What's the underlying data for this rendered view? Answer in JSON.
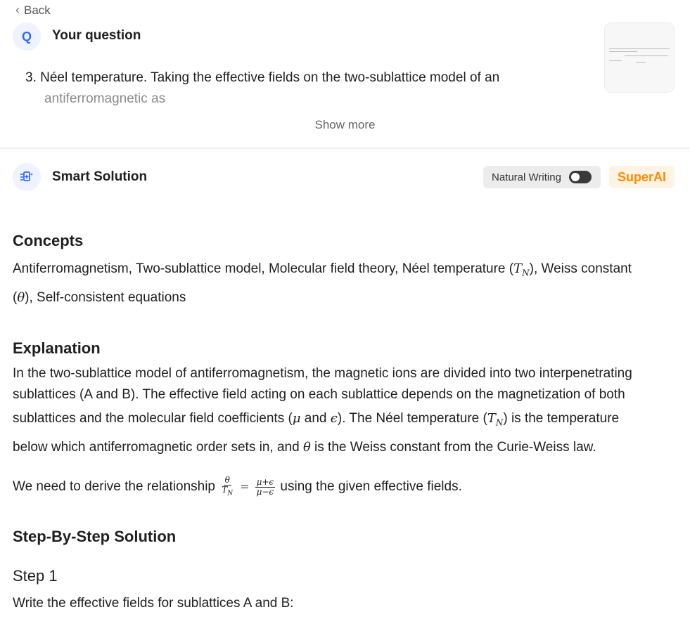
{
  "nav": {
    "back_label": "Back"
  },
  "question": {
    "badge": "Q",
    "title": "Your question",
    "number": "3.",
    "text_line1": "Néel temperature. Taking the effective fields on the two-sublattice model of an",
    "text_line2": "antiferromagnetic as",
    "show_more": "Show more"
  },
  "solution": {
    "title": "Smart Solution",
    "natural_writing_label": "Natural Writing",
    "natural_writing_on": false,
    "superai_label": "SuperAI"
  },
  "concepts": {
    "heading": "Concepts",
    "line1_a": "Antiferromagnetism, Two-sublattice model, Molecular field theory, Néel temperature (",
    "tn_T": "T",
    "tn_N": "N",
    "line1_b": "), Weiss constant",
    "line2_a": "(",
    "theta": "θ",
    "line2_b": "), Self-consistent equations"
  },
  "explanation": {
    "heading": "Explanation",
    "line1": "In the two-sublattice model of antiferromagnetism, the magnetic ions are divided into two interpenetrating",
    "line2": "sublattices (A and B). The effective field acting on each sublattice depends on the magnetization of both",
    "line3_a": "sublattices and the molecular field coefficients (",
    "mu": "μ",
    "and": " and ",
    "eps": "ϵ",
    "line3_b": "). The Néel temperature (",
    "tn_T": "T",
    "tn_N": "N",
    "line3_c": ") is the temperature",
    "line4_a": "below which antiferromagnetic order sets in, and ",
    "theta": "θ",
    "line4_b": " is the Weiss constant from the Curie-Weiss law.",
    "derive_a": "We need to derive the relationship ",
    "frac1_num": "θ",
    "frac1_den_T": "T",
    "frac1_den_N": "N",
    "equals": "=",
    "frac2_num": "μ+ϵ",
    "frac2_den": "μ−ϵ",
    "derive_b": " using the given effective fields."
  },
  "steps": {
    "heading": "Step-By-Step Solution",
    "step1_title": "Step 1",
    "step1_text": "Write the effective fields for sublattices A and B:"
  },
  "colors": {
    "accent_blue": "#2f6bff",
    "superai_orange": "#ff8a00",
    "superai_bg": "#fff4e3"
  }
}
